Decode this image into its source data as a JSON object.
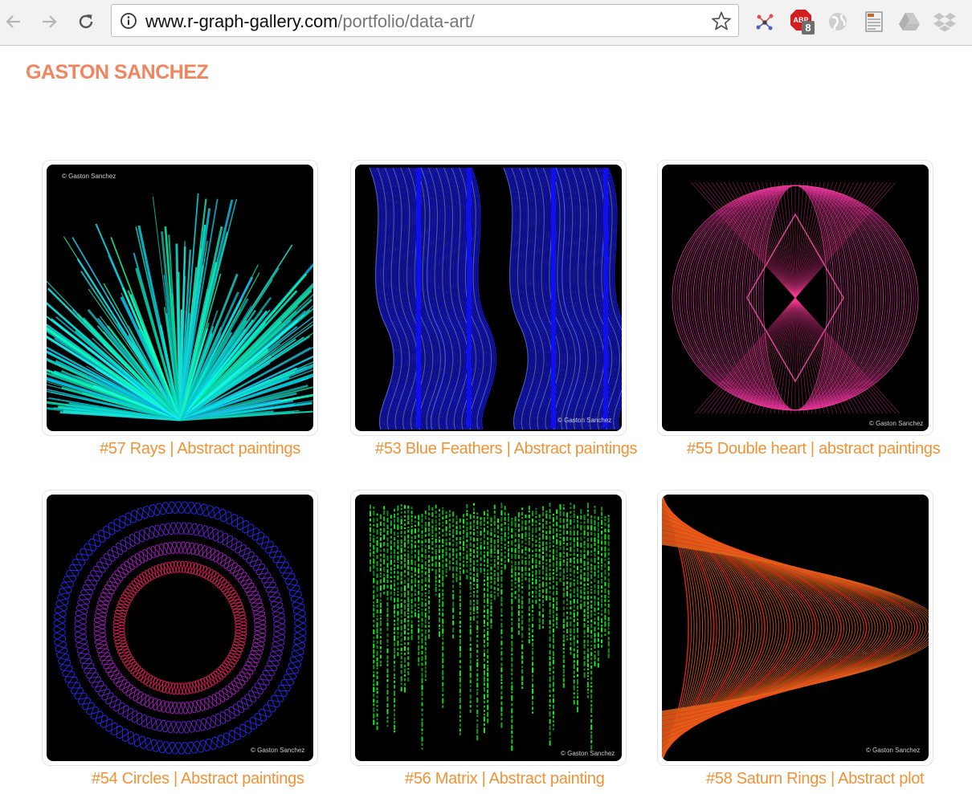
{
  "browser": {
    "url_host": "www.r-graph-gallery.com",
    "url_path": "/portfolio/data-art/"
  },
  "site": {
    "title": "GASTON SANCHEZ"
  },
  "gallery": {
    "items": [
      {
        "caption": "#57 Rays | Abstract paintings",
        "credit": "© Gaston Sanchez"
      },
      {
        "caption": "#53 Blue Feathers | Abstract paintings",
        "credit": "© Gaston Sanchez"
      },
      {
        "caption": "#55 Double heart | abstract paintings",
        "credit": "© Gaston Sanchez"
      },
      {
        "caption": "#54 Circles | Abstract paintings",
        "credit": "© Gaston Sanchez"
      },
      {
        "caption": "#56 Matrix | Abstract painting",
        "credit": "© Gaston Sanchez"
      },
      {
        "caption": "#58 Saturn Rings | Abstract plot",
        "credit": "© Gaston Sanchez"
      }
    ]
  },
  "extensions": {
    "adblock_badge": "8"
  },
  "colors": {
    "title": "#f08560",
    "caption": "#f39235"
  }
}
